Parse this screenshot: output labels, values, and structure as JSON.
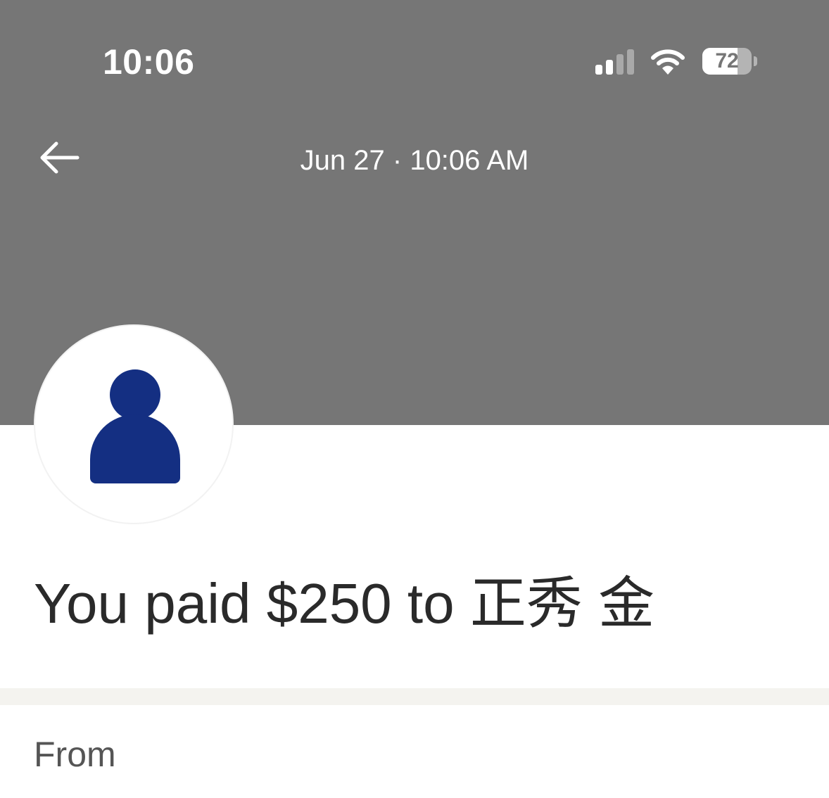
{
  "status_bar": {
    "time": "10:06",
    "battery_level": "72",
    "battery_fraction": 0.72,
    "icons": [
      "signal-icon",
      "wifi-icon",
      "battery-icon"
    ]
  },
  "header": {
    "back_icon": "arrow-left-icon",
    "date_time": "Jun 27 · 10:06 AM",
    "background_color": "#767676"
  },
  "transaction": {
    "avatar_icon": "person-icon",
    "avatar_color": "#142f82",
    "headline": "You paid $250 to 正秀 金"
  },
  "details": {
    "from_label": "From"
  }
}
